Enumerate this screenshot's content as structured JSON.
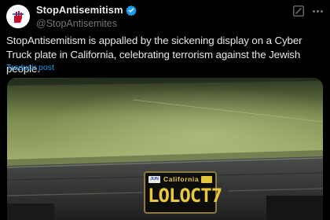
{
  "author": {
    "display_name": "StopAntisemitism",
    "handle": "@StopAntisemites",
    "verified_icon": "verified-badge-icon",
    "avatar_icon": "raised-hand-logo-icon"
  },
  "header_actions": {
    "grok_icon": "grok-slash-icon",
    "more_icon": "more-horizontal-icon"
  },
  "tweet": {
    "text": "StopAntisemitism is appalled by the sickening display on a Cyber Truck plate in California, celebrating terrorism against the Jewish people.",
    "translate_label": "Traducir post"
  },
  "media": {
    "plate_state": "California",
    "plate_month": "JUN",
    "plate_number": "LOLOCT7"
  },
  "colors": {
    "background": "#000000",
    "primary_text": "#e7e9ea",
    "secondary_text": "#71767b",
    "link": "#1d9bf0",
    "verified": "#1d9bf0",
    "plate_text": "#e9c83a"
  }
}
